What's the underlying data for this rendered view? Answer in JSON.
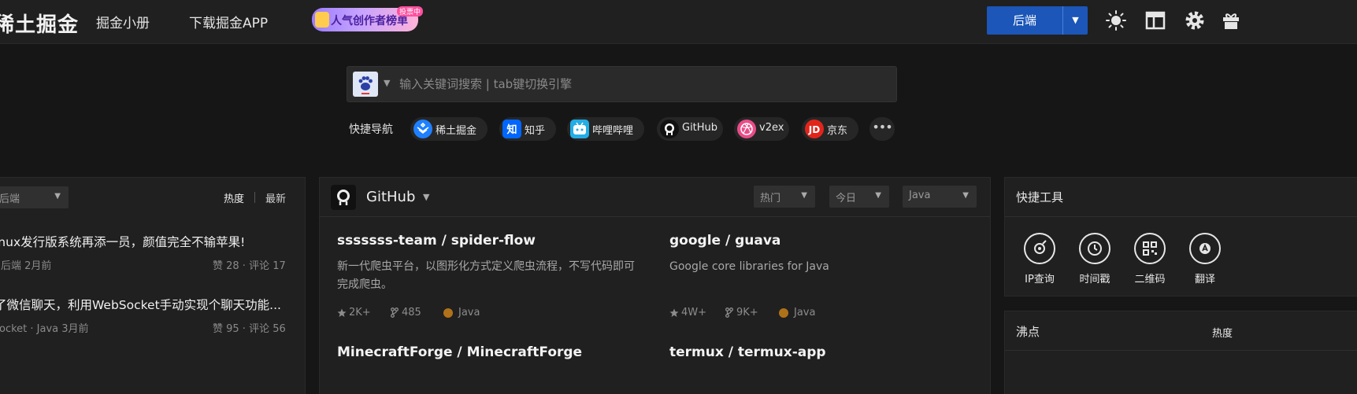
{
  "header": {
    "logo_text": "稀土掘金",
    "nav_links": [
      "掘金小册",
      "下载掘金APP"
    ],
    "banner_text": "人气创作者榜单",
    "banner_badge": "投票中",
    "category_button": "后端",
    "icons": [
      "sun-icon",
      "layout-icon",
      "gear-icon",
      "gift-icon"
    ]
  },
  "search": {
    "placeholder": "输入关键词搜索 | tab键切换引擎",
    "engine_icon": "baidu-paw-icon"
  },
  "quick_nav": {
    "label": "快捷导航",
    "items": [
      {
        "label": "稀土掘金",
        "icon": "juejin-icon",
        "color": "#1e80ff"
      },
      {
        "label": "知乎",
        "icon": "zhihu-icon",
        "color": "#0066ff"
      },
      {
        "label": "哔哩哔哩",
        "icon": "bilibili-icon",
        "color": "#23ade5"
      },
      {
        "label": "GitHub",
        "icon": "github-icon",
        "color": "#111111"
      },
      {
        "label": "v2ex",
        "icon": "dribbble-icon",
        "color": "#ea4c89"
      },
      {
        "label": "京东",
        "icon": "jd-icon",
        "color": "#e1251b"
      }
    ],
    "more_icon": "more-dots-icon"
  },
  "left_panel": {
    "category_select": "后端",
    "tab_hot": "热度",
    "tab_new": "最新",
    "articles": [
      {
        "title": "inux发行版系统再添一员，颜值完全不输苹果!",
        "meta": "后端   2月前",
        "stats": "赞 28 · 评论 17"
      },
      {
        "title": "了微信聊天，利用WebSocket手动实现个聊天功能...",
        "meta": "ocket · Java   3月前",
        "stats": "赞 95 · 评论 56"
      }
    ]
  },
  "github_panel": {
    "title": "GitHub",
    "filters": [
      "热门",
      "今日",
      "Java"
    ],
    "repos": [
      {
        "name": "sssssss-team / spider-flow",
        "desc": "新一代爬虫平台，以图形化方式定义爬虫流程，不写代码即可完成爬虫。",
        "stars": "2K+",
        "forks": "485",
        "lang": "Java"
      },
      {
        "name": "google / guava",
        "desc": "Google core libraries for Java",
        "stars": "4W+",
        "forks": "9K+",
        "lang": "Java"
      },
      {
        "name": "MinecraftForge / MinecraftForge",
        "desc": "",
        "stars": "",
        "forks": "",
        "lang": ""
      },
      {
        "name": "termux / termux-app",
        "desc": "",
        "stars": "",
        "forks": "",
        "lang": ""
      }
    ],
    "lang_color": "#b07219"
  },
  "tools_panel": {
    "title": "快捷工具",
    "tools": [
      {
        "label": "IP查询",
        "icon": "ip-location-icon"
      },
      {
        "label": "时间戳",
        "icon": "timestamp-clock-icon"
      },
      {
        "label": "二维码",
        "icon": "qrcode-icon"
      },
      {
        "label": "翻译",
        "icon": "translate-icon"
      }
    ]
  },
  "hot_panel": {
    "title": "沸点",
    "tab": "热度"
  }
}
